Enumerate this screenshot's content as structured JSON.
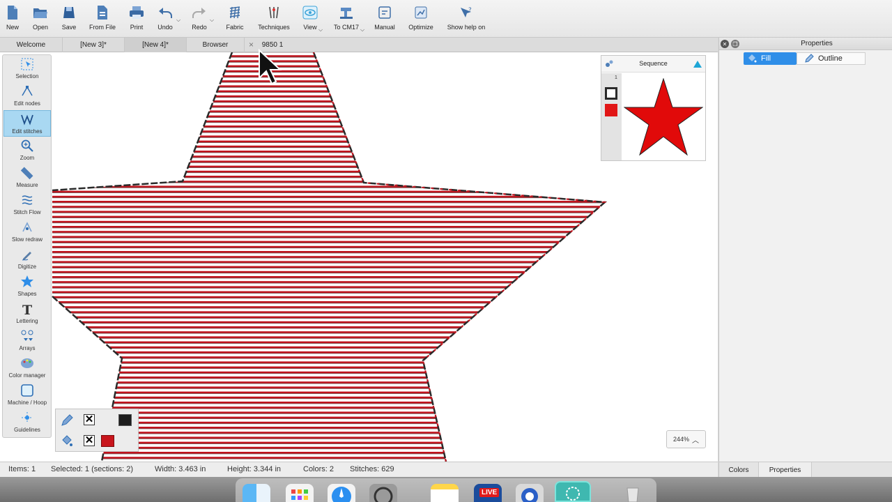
{
  "toolbar": {
    "items": [
      {
        "label": "New",
        "icon": "new-file-icon"
      },
      {
        "label": "Open",
        "icon": "open-folder-icon"
      },
      {
        "label": "Save",
        "icon": "save-icon"
      },
      {
        "label": "From File",
        "icon": "import-file-icon"
      },
      {
        "label": "Print",
        "icon": "printer-icon"
      },
      {
        "label": "Undo",
        "icon": "undo-icon"
      },
      {
        "label": "Redo",
        "icon": "redo-icon"
      },
      {
        "label": "Fabric",
        "icon": "fabric-icon"
      },
      {
        "label": "Techniques",
        "icon": "techniques-icon"
      },
      {
        "label": "View",
        "icon": "eye-icon"
      },
      {
        "label": "To CM17",
        "icon": "machine-icon"
      },
      {
        "label": "Manual",
        "icon": "manual-icon"
      },
      {
        "label": "Optimize",
        "icon": "optimize-icon"
      },
      {
        "label": "Show help on",
        "icon": "help-pointer-icon"
      }
    ]
  },
  "tabs": [
    {
      "label": "Welcome"
    },
    {
      "label": "[New 3]*"
    },
    {
      "label": "[New 4]*"
    },
    {
      "label": "Browser"
    },
    {
      "label": "9850 1"
    }
  ],
  "tools": [
    {
      "label": "Selection",
      "icon": "selection-icon"
    },
    {
      "label": "Edit nodes",
      "icon": "edit-nodes-icon"
    },
    {
      "label": "Edit stitches",
      "icon": "edit-stitches-icon",
      "active": true
    },
    {
      "label": "Zoom",
      "icon": "zoom-icon"
    },
    {
      "label": "Measure",
      "icon": "ruler-icon"
    },
    {
      "label": "Stitch Flow",
      "icon": "stitch-flow-icon"
    },
    {
      "label": "Slow redraw",
      "icon": "slow-redraw-icon"
    },
    {
      "label": "Digitize",
      "icon": "digitize-icon"
    },
    {
      "label": "Shapes",
      "icon": "shapes-icon"
    },
    {
      "label": "Lettering",
      "icon": "lettering-icon"
    },
    {
      "label": "Arrays",
      "icon": "arrays-icon"
    },
    {
      "label": "Color manager",
      "icon": "palette-icon"
    },
    {
      "label": "Machine / Hoop",
      "icon": "hoop-icon"
    },
    {
      "label": "Guidelines",
      "icon": "guidelines-icon"
    }
  ],
  "sequence": {
    "title": "Sequence",
    "index": "1"
  },
  "properties_panel": {
    "title": "Properties",
    "fill_label": "Fill",
    "outline_label": "Outline"
  },
  "zoom": {
    "level": "244%"
  },
  "status": {
    "items": "Items: 1",
    "selected": "Selected: 1 (sections: 2)",
    "width": "Width: 3.463 in",
    "height": "Height: 3.344 in",
    "colors": "Colors: 2",
    "stitches": "Stitches: 629"
  },
  "bottom_tabs": [
    {
      "label": "Colors"
    },
    {
      "label": "Properties"
    }
  ],
  "dock": {
    "live_label": "LIVE"
  },
  "colors": {
    "stitch_red": "#d3111d",
    "outline_dark": "#2a2a2a",
    "accent_blue": "#2f8ee8",
    "active_tool": "#a9d8f2"
  }
}
